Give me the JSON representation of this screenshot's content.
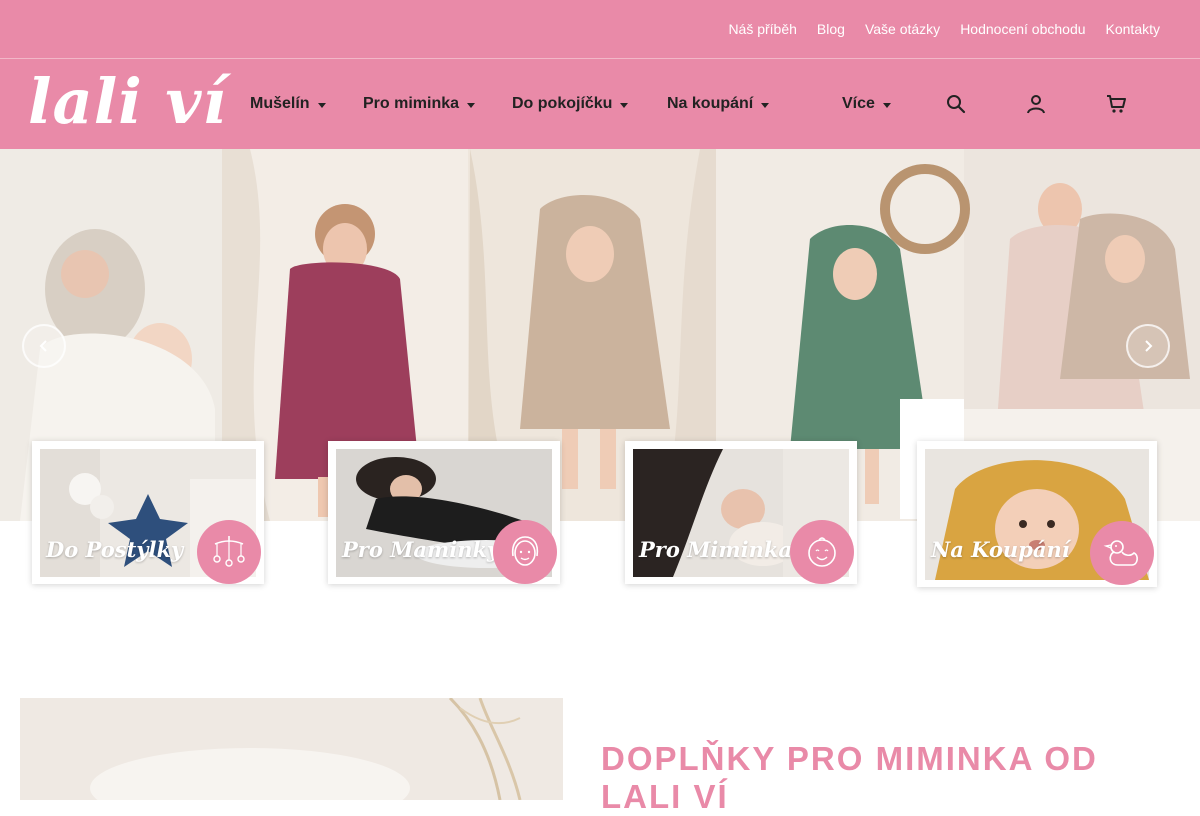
{
  "topbar": {
    "links": [
      "Náš příběh",
      "Blog",
      "Vaše otázky",
      "Hodnocení obchodu",
      "Kontakty"
    ]
  },
  "header": {
    "logo_text": "lali ví",
    "nav": [
      "Mušelín",
      "Pro miminka",
      "Do pokojíčku",
      "Na koupání",
      "Více"
    ],
    "icons": [
      "search-icon",
      "user-icon",
      "cart-icon"
    ]
  },
  "hero": {
    "prev_icon": "chevron-left-icon",
    "next_icon": "chevron-right-icon"
  },
  "categories": [
    {
      "title": "Do Postýlky",
      "icon": "baby-mobile-icon"
    },
    {
      "title": "Pro Maminky",
      "icon": "woman-face-icon"
    },
    {
      "title": "Pro Miminka",
      "icon": "baby-face-icon"
    },
    {
      "title": "Na Koupání",
      "icon": "rubber-duck-icon"
    }
  ],
  "about": {
    "title": "DOPLŇKY PRO MIMINKA OD LALI VÍ"
  },
  "colors": {
    "brand_pink": "#e98aa8",
    "text_dark": "#222222"
  }
}
